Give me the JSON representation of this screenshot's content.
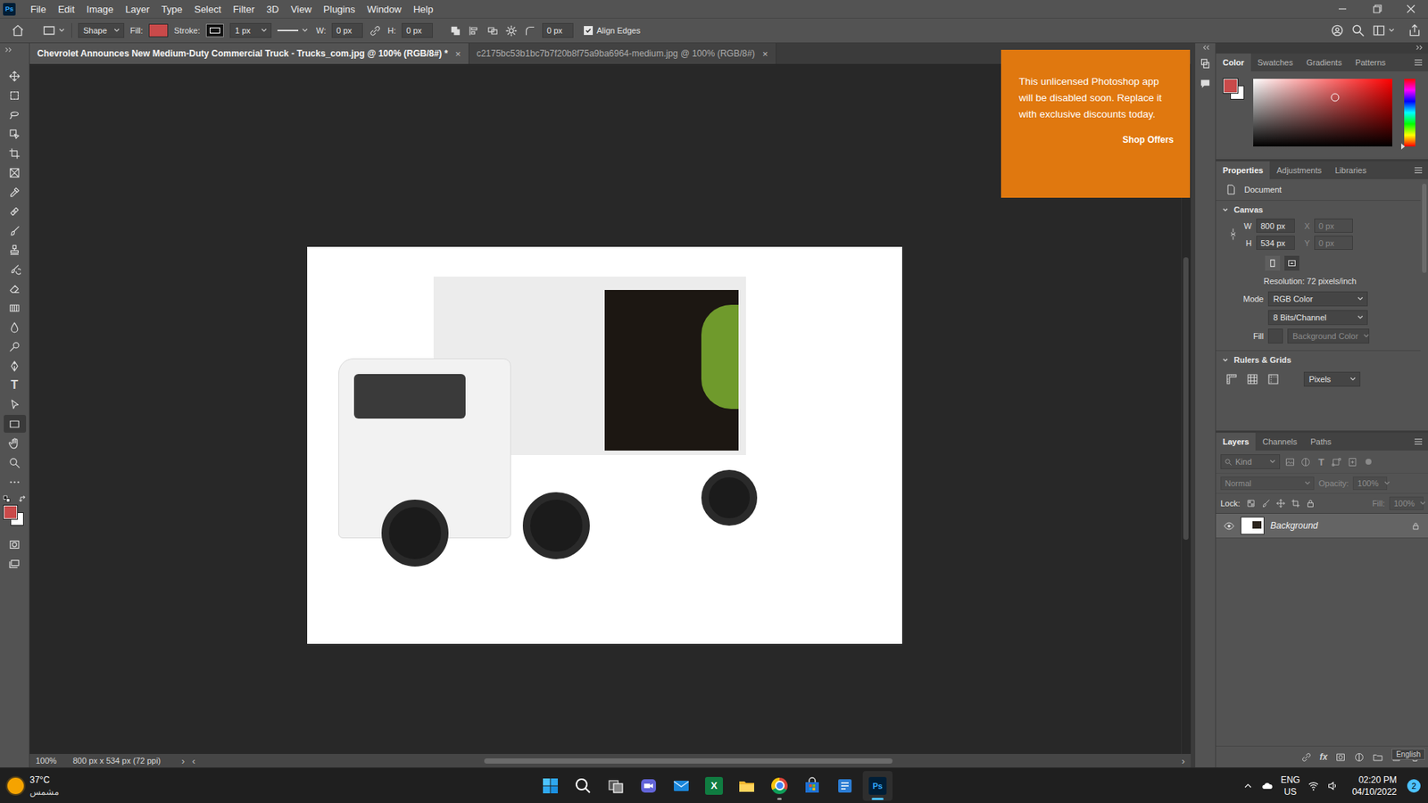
{
  "app": {
    "logo": "Ps"
  },
  "menu": [
    "File",
    "Edit",
    "Image",
    "Layer",
    "Type",
    "Select",
    "Filter",
    "3D",
    "View",
    "Plugins",
    "Window",
    "Help"
  ],
  "options_bar": {
    "tool_mode": "Shape",
    "fill_label": "Fill:",
    "fill_color": "#c94a4a",
    "stroke_label": "Stroke:",
    "stroke_width": "1 px",
    "w_label": "W:",
    "w_value": "0 px",
    "h_label": "H:",
    "h_value": "0 px",
    "corner_radius": "0 px",
    "align_edges": {
      "label": "Align Edges",
      "checked": true
    }
  },
  "document_tabs": [
    {
      "label": "Chevrolet Announces New Medium-Duty Commercial Truck - Trucks_com.jpg @ 100% (RGB/8#) *",
      "selected": true,
      "close": "×"
    },
    {
      "label": "c2175bc53b1bc7b7f20b8f75a9ba6964-medium.jpg @ 100% (RGB/8#)",
      "selected": false,
      "close": "×"
    }
  ],
  "tools": [
    {
      "kind": "move",
      "selected": false
    },
    {
      "kind": "marquee",
      "selected": false
    },
    {
      "kind": "lasso",
      "selected": false
    },
    {
      "kind": "objectselect",
      "selected": false
    },
    {
      "kind": "crop",
      "selected": false
    },
    {
      "kind": "frame",
      "selected": false
    },
    {
      "kind": "eyedropper",
      "selected": false
    },
    {
      "kind": "healing",
      "selected": false
    },
    {
      "kind": "brush",
      "selected": false
    },
    {
      "kind": "stamp",
      "selected": false
    },
    {
      "kind": "historybrush",
      "selected": false
    },
    {
      "kind": "eraser",
      "selected": false
    },
    {
      "kind": "gradient",
      "selected": false
    },
    {
      "kind": "blur",
      "selected": false
    },
    {
      "kind": "dodge",
      "selected": false
    },
    {
      "kind": "pen",
      "selected": false
    },
    {
      "kind": "type",
      "glyph": "T",
      "selected": false
    },
    {
      "kind": "pathselect",
      "selected": false
    },
    {
      "kind": "rectangle",
      "selected": true
    },
    {
      "kind": "hand",
      "selected": false
    },
    {
      "kind": "zoom",
      "selected": false
    },
    {
      "kind": "more",
      "selected": false
    },
    {
      "kind": "colors",
      "foreground": "#c94a4a",
      "background": "#ffffff",
      "selected": false
    },
    {
      "kind": "quickmask",
      "selected": false
    },
    {
      "kind": "screenmode",
      "selected": false
    }
  ],
  "scrollbars": {
    "vertical": {
      "offset": 0.28,
      "level": 0.41
    },
    "horizontal": {
      "offset": 0.29,
      "level": 0.42
    }
  },
  "status_bar": {
    "zoom": "100%",
    "info": "800 px x 534 px (72 ppi)",
    "more": "›",
    "scroll_left": "‹",
    "scroll_right": "›"
  },
  "notification": {
    "text": "This unlicensed Photoshop app will be disabled soon. Replace it with exclusive discounts today.",
    "action": "Shop Offers"
  },
  "color_panel": {
    "tabs": [
      {
        "label": "Color",
        "selected": true
      },
      {
        "label": "Swatches",
        "selected": false
      },
      {
        "label": "Gradients",
        "selected": false
      },
      {
        "label": "Patterns",
        "selected": false
      }
    ],
    "foreground": "#c94a4a",
    "background": "#ffffff",
    "saturation": 0.59,
    "brightness": 0.72,
    "hue": 0
  },
  "properties_panel": {
    "tabs": [
      {
        "label": "Properties",
        "selected": true
      },
      {
        "label": "Adjustments",
        "selected": false
      },
      {
        "label": "Libraries",
        "selected": false
      }
    ],
    "document_label": "Document",
    "canvas": {
      "title": "Canvas",
      "expanded": true,
      "w_label": "W",
      "w_value": "800 px",
      "h_label": "H",
      "h_value": "534 px",
      "x_label": "X",
      "x_value": "0 px",
      "y_label": "Y",
      "y_value": "0 px",
      "xy_disabled": true,
      "resolution": "Resolution: 72 pixels/inch",
      "mode_label": "Mode",
      "mode": "RGB Color",
      "depth": "8 Bits/Channel",
      "fill_label": "Fill",
      "fill": "Background Color",
      "fill_disabled": true
    },
    "rulers": {
      "title": "Rulers & Grids",
      "expanded": true,
      "units": "Pixels"
    }
  },
  "layers_panel": {
    "tabs": [
      {
        "label": "Layers",
        "selected": true
      },
      {
        "label": "Channels",
        "selected": false
      },
      {
        "label": "Paths",
        "selected": false
      }
    ],
    "filter_placeholder": "Kind",
    "filter_icons": [
      {
        "kind": "pixel"
      },
      {
        "kind": "adjustment"
      },
      {
        "kind": "type",
        "glyph": "T"
      },
      {
        "kind": "shape"
      },
      {
        "kind": "smart"
      }
    ],
    "blend_mode": "Normal",
    "opacity_label": "Opacity:",
    "opacity": "100%",
    "lock_label": "Lock:",
    "fill_label": "Fill:",
    "fill": "100%",
    "controls_disabled": true,
    "layers": [
      {
        "name": "Background",
        "visible": true,
        "locked": true,
        "selected": true
      }
    ],
    "bottom_icons": [
      {
        "kind": "link"
      },
      {
        "kind": "fx",
        "glyph": "fx"
      },
      {
        "kind": "mask"
      },
      {
        "kind": "adjust"
      },
      {
        "kind": "group"
      },
      {
        "kind": "new"
      },
      {
        "kind": "trash"
      }
    ],
    "tooltip": "English"
  },
  "taskbar": {
    "weather": {
      "temperature": "37°C",
      "condition": "مشمس"
    },
    "apps": [
      {
        "kind": "start",
        "selected": false,
        "running": false
      },
      {
        "kind": "search",
        "selected": false,
        "running": false
      },
      {
        "kind": "taskview",
        "selected": false,
        "running": false
      },
      {
        "kind": "teams",
        "selected": false,
        "running": false
      },
      {
        "kind": "mail",
        "selected": false,
        "running": false
      },
      {
        "kind": "excel",
        "glyph": "X",
        "selected": false,
        "running": false
      },
      {
        "kind": "explorer",
        "selected": false,
        "running": false
      },
      {
        "kind": "chrome",
        "selected": false,
        "running": true
      },
      {
        "kind": "store",
        "selected": false,
        "running": false
      },
      {
        "kind": "blueapp",
        "selected": false,
        "running": false
      },
      {
        "kind": "photoshop",
        "glyph": "Ps",
        "selected": true,
        "running": true
      }
    ],
    "language": "ENG",
    "region": "US",
    "time": "02:20 PM",
    "date": "04/10/2022",
    "notifications": "2"
  }
}
